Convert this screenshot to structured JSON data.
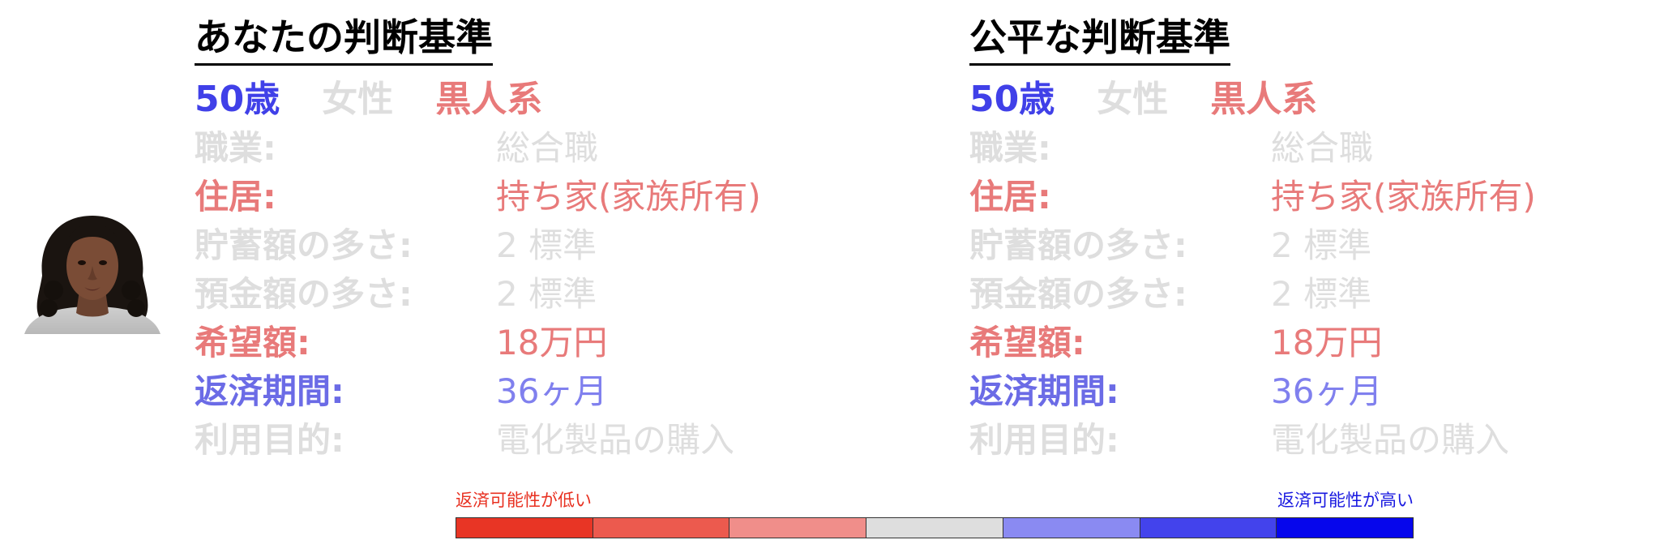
{
  "colors": {
    "accent_blue": "#4040e8",
    "value_blue": "#8080ee",
    "accent_red": "#e87a7a",
    "muted_gray": "#dedede",
    "legend_low_text": "#e83020",
    "legend_high_text": "#1818e0"
  },
  "portrait": {
    "icon": "woman-portrait-photo"
  },
  "panels": [
    {
      "title": "あなたの判断基準",
      "profile": {
        "age": "50歳",
        "gender": "女性",
        "race": "黒人系"
      },
      "rows": [
        {
          "label": "職業:",
          "value": "総合職",
          "emphasis": "gray"
        },
        {
          "label": "住居:",
          "value": "持ち家(家族所有)",
          "emphasis": "red"
        },
        {
          "label": "貯蓄額の多さ:",
          "value": "2 標準",
          "emphasis": "gray"
        },
        {
          "label": "預金額の多さ:",
          "value": "2 標準",
          "emphasis": "gray"
        },
        {
          "label": "希望額:",
          "value": "18万円",
          "emphasis": "red"
        },
        {
          "label": "返済期間:",
          "value": "36ヶ月",
          "emphasis": "blue"
        },
        {
          "label": "利用目的:",
          "value": "電化製品の購入",
          "emphasis": "gray"
        }
      ]
    },
    {
      "title": "公平な判断基準",
      "profile": {
        "age": "50歳",
        "gender": "女性",
        "race": "黒人系"
      },
      "rows": [
        {
          "label": "職業:",
          "value": "総合職",
          "emphasis": "gray"
        },
        {
          "label": "住居:",
          "value": "持ち家(家族所有)",
          "emphasis": "red"
        },
        {
          "label": "貯蓄額の多さ:",
          "value": "2 標準",
          "emphasis": "gray"
        },
        {
          "label": "預金額の多さ:",
          "value": "2 標準",
          "emphasis": "gray"
        },
        {
          "label": "希望額:",
          "value": "18万円",
          "emphasis": "red"
        },
        {
          "label": "返済期間:",
          "value": "36ヶ月",
          "emphasis": "blue"
        },
        {
          "label": "利用目的:",
          "value": "電化製品の購入",
          "emphasis": "gray"
        }
      ]
    }
  ],
  "legend": {
    "low_label": "返済可能性が低い",
    "high_label": "返済可能性が高い",
    "scale_colors": [
      "#e83525",
      "#ec5a4e",
      "#f08e8a",
      "#dedede",
      "#8a8af2",
      "#4343ec",
      "#0606ec"
    ]
  }
}
